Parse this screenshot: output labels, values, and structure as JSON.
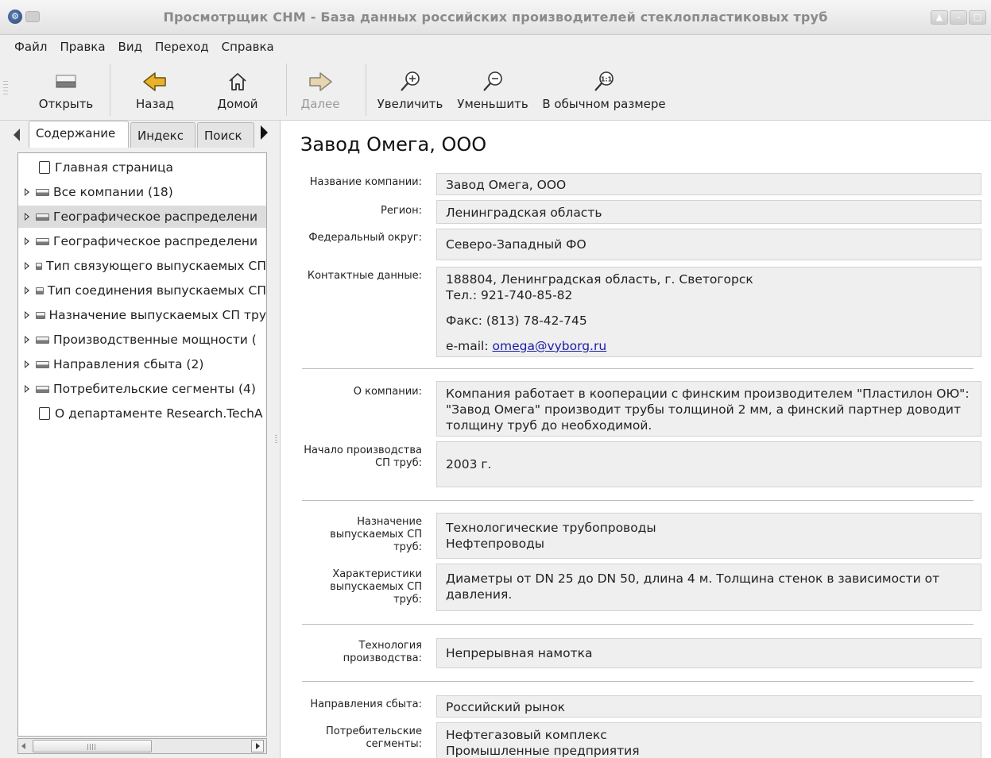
{
  "window": {
    "title": "Просмотрщик CHM - База данных российских производителей стеклопластиковых труб",
    "app_icon": "chm-viewer-icon"
  },
  "menu": [
    {
      "label": "Файл"
    },
    {
      "label": "Правка"
    },
    {
      "label": "Вид"
    },
    {
      "label": "Переход"
    },
    {
      "label": "Справка"
    }
  ],
  "toolbar": {
    "open": "Открыть",
    "back": "Назад",
    "home": "Домой",
    "forward": "Далее",
    "zoom_in": "Увеличить",
    "zoom_out": "Уменьшить",
    "normal_size": "В обычном размере"
  },
  "tabs": {
    "contents": "Содержание",
    "index": "Индекс",
    "search": "Поиск"
  },
  "tree": [
    {
      "label": "Главная страница",
      "type": "page"
    },
    {
      "label": "Все компании (18)",
      "type": "book"
    },
    {
      "label": "Географическое распределени",
      "type": "book",
      "selected": true
    },
    {
      "label": "Географическое распределени",
      "type": "book"
    },
    {
      "label": "Тип связующего выпускаемых СП",
      "type": "book"
    },
    {
      "label": "Тип соединения выпускаемых СП",
      "type": "book"
    },
    {
      "label": "Назначение выпускаемых СП тру",
      "type": "book"
    },
    {
      "label": "Производственные мощности (",
      "type": "book"
    },
    {
      "label": "Направления сбыта (2)",
      "type": "book"
    },
    {
      "label": "Потребительские сегменты (4)",
      "type": "book"
    },
    {
      "label": "О департаменте Research.TechA",
      "type": "page"
    }
  ],
  "page": {
    "title": "Завод Омега, ООО",
    "fields": {
      "company_name": {
        "label": "Название компании:",
        "value": "Завод Омега, ООО"
      },
      "region": {
        "label": "Регион:",
        "value": "Ленинградская область"
      },
      "federal_district": {
        "label": "Федеральный округ:",
        "value": "Северо-Западный ФО"
      },
      "contacts": {
        "label": "Контактные данные:",
        "address": "188804, Ленинградская область, г. Светогорск",
        "phone": "Тел.: 921-740-85-82",
        "fax": "Факс: (813) 78-42-745",
        "email_prefix": "e-mail: ",
        "email": "omega@vyborg.ru"
      },
      "about": {
        "label": "О компании:",
        "value": "Компания работает в кооперации с финским производителем \"Пластилон ОЮ\": \"Завод Омега\" производит трубы толщиной 2 мм, а финский партнер доводит толщину труб до необходимой."
      },
      "start": {
        "label": "Начало производства СП труб:",
        "value": "2003 г."
      },
      "purpose": {
        "label": "Назначение выпускаемых СП труб:",
        "line1": "Технологические трубопроводы",
        "line2": "Нефтепроводы"
      },
      "characteristics": {
        "label": "Характеристики выпускаемых СП труб:",
        "value": "Диаметры от DN 25 до DN 50, длина 4 м. Толщина стенок в зависимости от давления."
      },
      "technology": {
        "label": "Технология производства:",
        "value": "Непрерывная намотка"
      },
      "sales": {
        "label": "Направления сбыта:",
        "value": "Российский рынок"
      },
      "segments": {
        "label": "Потребительские сегменты:",
        "line1": "Нефтегазовый комплекс",
        "line2": "Промышленные предприятия"
      }
    }
  }
}
